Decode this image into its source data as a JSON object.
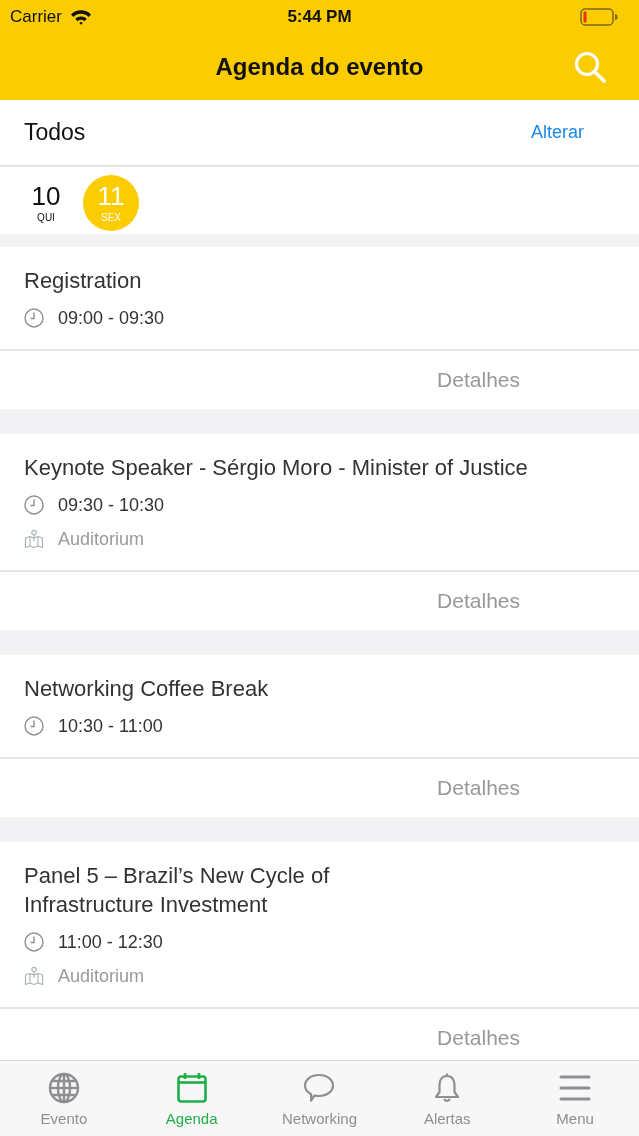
{
  "status_bar": {
    "carrier": "Carrier",
    "time": "5:44 PM"
  },
  "nav_bar": {
    "title": "Agenda do evento"
  },
  "filter": {
    "label": "Todos",
    "action": "Alterar"
  },
  "dates": [
    {
      "day": "10",
      "weekday": "QUI",
      "selected": false
    },
    {
      "day": "11",
      "weekday": "SEX",
      "selected": true
    }
  ],
  "sessions": [
    {
      "title": "Registration",
      "time": "09:00 - 09:30",
      "details": "Detalhes"
    },
    {
      "title": "Keynote Speaker - Sérgio Moro - Minister of Justice",
      "time": "09:30 - 10:30",
      "location": "Auditorium",
      "details": "Detalhes"
    },
    {
      "title": "Networking Coffee Break",
      "time": "10:30 - 11:00",
      "details": "Detalhes"
    },
    {
      "title": "Panel 5 – Brazil’s New Cycle of\nInfrastructure Investment",
      "time": "11:00 - 12:30",
      "location": "Auditorium",
      "details": "Detalhes"
    }
  ],
  "tab_bar": [
    {
      "label": "Evento",
      "selected": false
    },
    {
      "label": "Agenda",
      "selected": true
    },
    {
      "label": "Networking",
      "selected": false
    },
    {
      "label": "Alertas",
      "selected": false
    },
    {
      "label": "Menu",
      "selected": false
    }
  ]
}
